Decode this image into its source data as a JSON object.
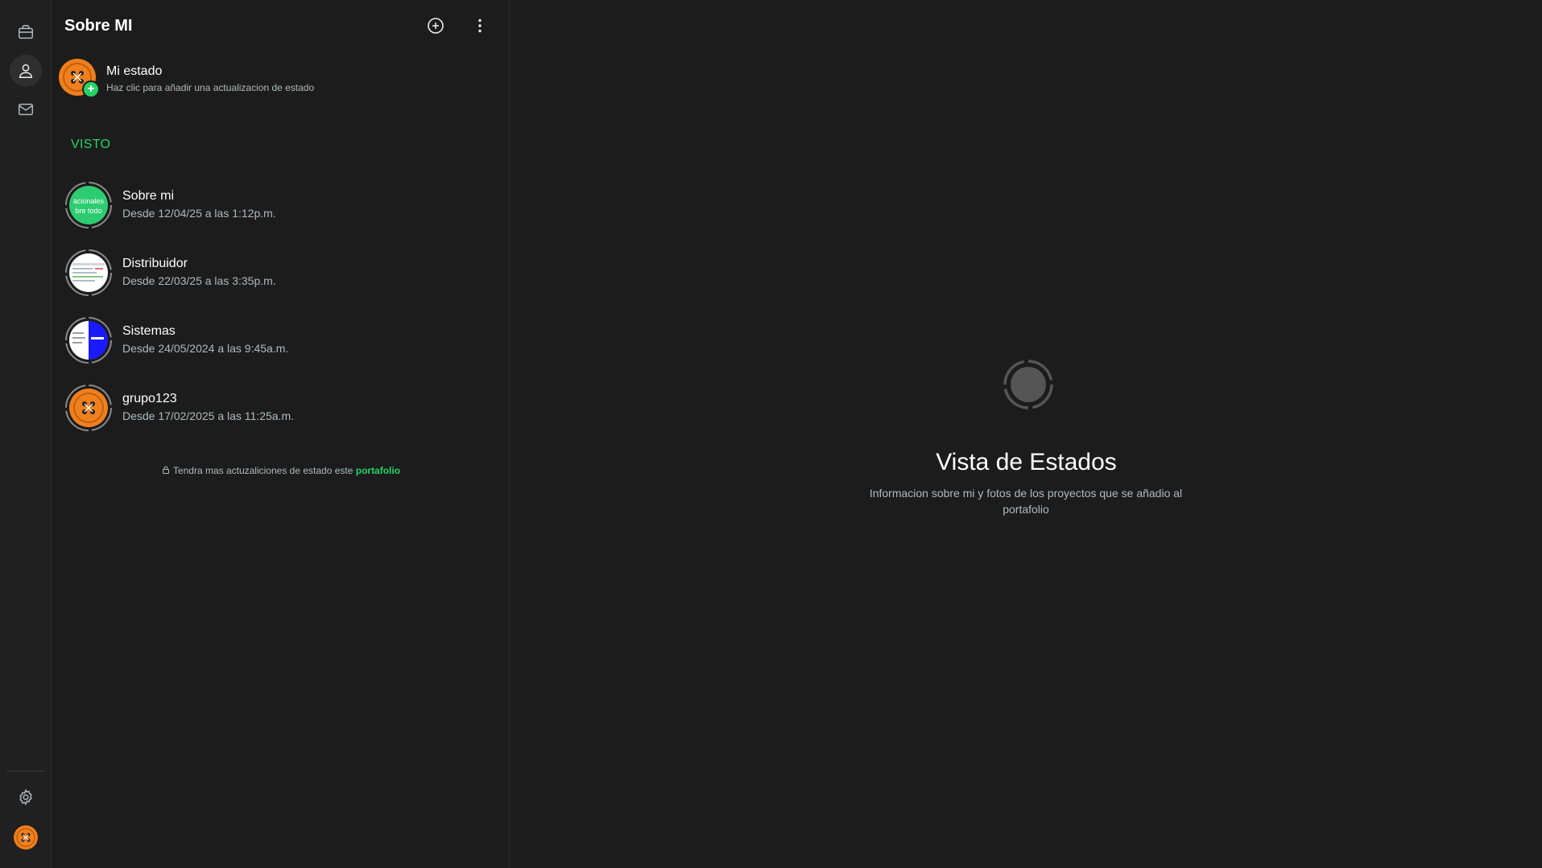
{
  "rail": {
    "items": [
      {
        "icon": "briefcase-icon"
      },
      {
        "icon": "user-icon",
        "active": true
      },
      {
        "icon": "mail-icon"
      }
    ],
    "settings_icon": "gear-icon",
    "profile_icon": "orange-button-avatar"
  },
  "panel": {
    "title": "Sobre MI",
    "add_icon": "plus-circle-icon",
    "menu_icon": "kebab-menu-icon",
    "my_status": {
      "name": "Mi estado",
      "subtitle": "Haz clic para añadir una actualizacion de estado"
    },
    "section_label": "VISTO",
    "statuses": [
      {
        "title": "Sobre mi",
        "time": "Desde 12/04/25 a las 1:12p.m.",
        "thumb_text": "acionales bre todo"
      },
      {
        "title": "Distribuidor",
        "time": "Desde 22/03/25 a las 3:35p.m."
      },
      {
        "title": "Sistemas",
        "time": "Desde 24/05/2024 a las 9:45a.m."
      },
      {
        "title": "grupo123",
        "time": "Desde 17/02/2025 a las 11:25a.m."
      }
    ],
    "footnote": {
      "text": "Tendra mas actuzaliciones de estado este",
      "link": "portafolio"
    }
  },
  "main": {
    "title": "Vista de Estados",
    "description": "Informacion sobre mi y fotos de los proyectos que se añadio al portafolio"
  },
  "colors": {
    "accent": "#25d366",
    "background": "#1c1c1c",
    "rail": "#202020",
    "avatar_orange": "#f07f1e"
  }
}
